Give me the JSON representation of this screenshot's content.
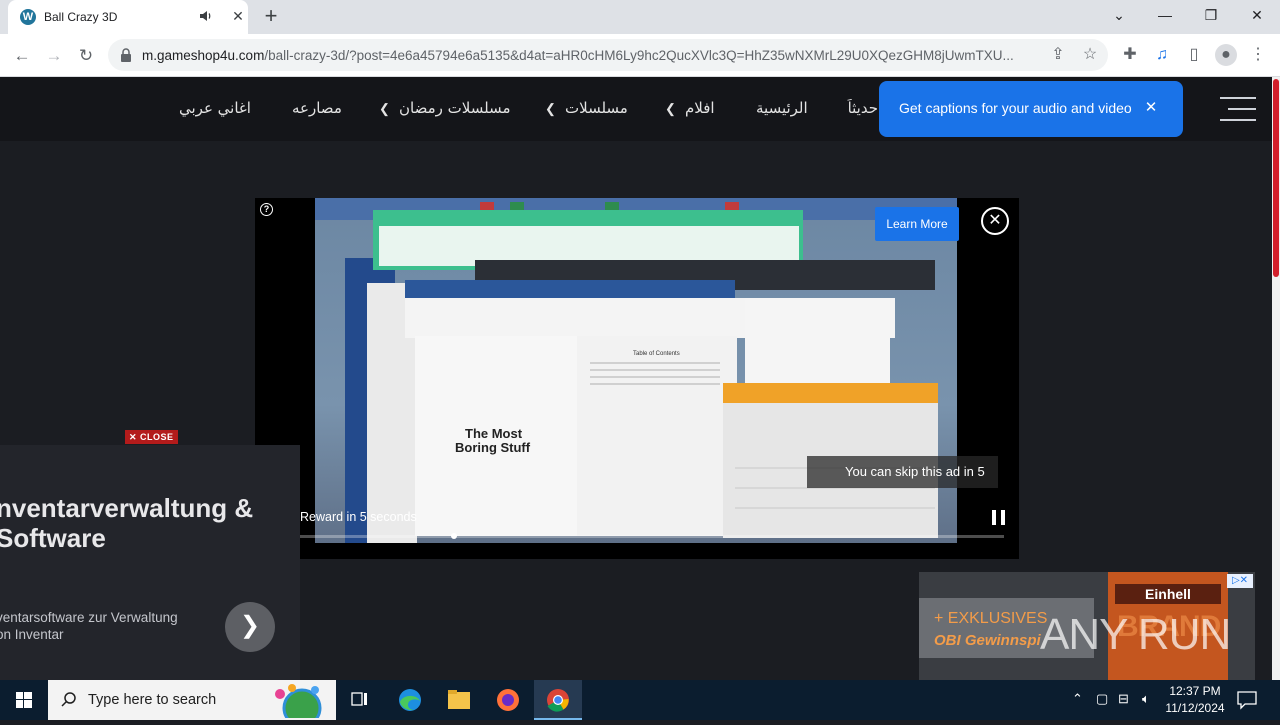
{
  "browser": {
    "tab_title": "Ball Crazy 3D",
    "tab_favicon": "W",
    "url_host": "m.gameshop4u.com",
    "url_path": "/ball-crazy-3d/?post=4e6a45794e6a5135&d4at=aHR0cHM6Ly9hc2QucXVlc3Q=HhZ35wNXMrL29U0XQezGHM8jUwmTXU..."
  },
  "site_nav": {
    "items": [
      "اغاني عربي",
      "مصارعه",
      "مسلسلات رمضان",
      "مسلسلات",
      "افلام",
      "الرئيسية",
      "حديثاً"
    ]
  },
  "captions_bubble": {
    "text": "Get captions for your audio and video"
  },
  "ad_player": {
    "learn_more": "Learn More",
    "skip_text": "You can skip this ad in 5",
    "reward_text": "Reward in 5 seconds",
    "progress_fraction": 0.25,
    "video_title": "The Most Boring Stuff",
    "video_toc": "Table of Contents"
  },
  "left_ad": {
    "close_label": "CLOSE",
    "headline_1": "nventarverwaltung &",
    "headline_2": "Software",
    "sub_1": "ventarsoftware zur Verwaltung",
    "sub_2": "on Inventar"
  },
  "right_ad": {
    "line_1": "+ EXKLUSIVES",
    "line_2": "OBI Gewinnspi",
    "brand": "Einhell",
    "brand_sub": "BRAND"
  },
  "watermark": "ANY RUN",
  "taskbar": {
    "search_placeholder": "Type here to search",
    "time": "12:37 PM",
    "date": "11/12/2024"
  },
  "colors": {
    "accent_blue": "#1a73e8",
    "site_bg": "#1b1d22",
    "scroll_red": "#d21f2b"
  }
}
